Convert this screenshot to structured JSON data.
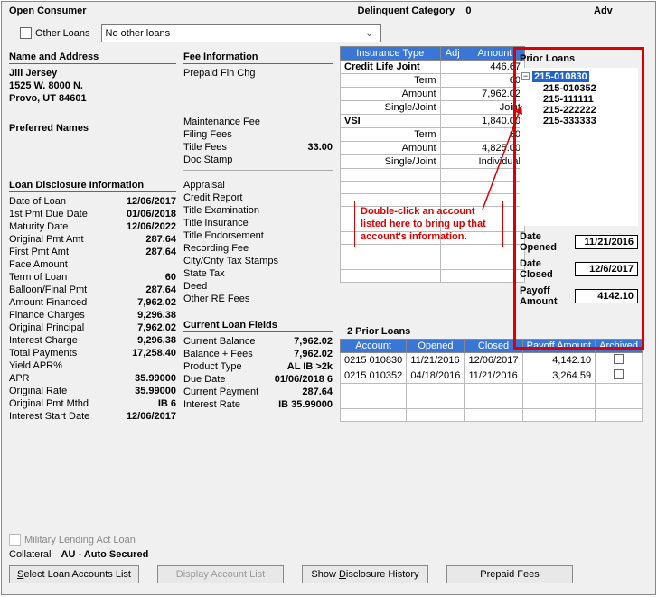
{
  "header": {
    "title": "Open Consumer",
    "delinquent_label": "Delinquent Category",
    "delinquent_value": "0",
    "adv_label": "Adv"
  },
  "other_loans": {
    "checkbox_label": "Other Loans",
    "dropdown_value": "No other loans"
  },
  "name_address": {
    "title": "Name and Address",
    "name": "Jill Jersey",
    "addr1": "1525 W. 8000 N.",
    "addr2": "Provo, UT  84601"
  },
  "preferred_names": {
    "title": "Preferred Names"
  },
  "loan_disclosure": {
    "title": "Loan Disclosure Information",
    "rows": [
      {
        "k": "Date of Loan",
        "v": "12/06/2017"
      },
      {
        "k": "1st Pmt Due Date",
        "v": "01/06/2018"
      },
      {
        "k": "Maturity Date",
        "v": "12/06/2022"
      },
      {
        "k": "Original Pmt Amt",
        "v": "287.64"
      },
      {
        "k": "First Pmt Amt",
        "v": "287.64"
      },
      {
        "k": "Face Amount",
        "v": ""
      },
      {
        "k": "Term of Loan",
        "v": "60"
      },
      {
        "k": "Balloon/Final Pmt",
        "v": "287.64"
      },
      {
        "k": "Amount Financed",
        "v": "7,962.02"
      },
      {
        "k": "Finance Charges",
        "v": "9,296.38"
      },
      {
        "k": "Original Principal",
        "v": "7,962.02"
      },
      {
        "k": "Interest Charge",
        "v": "9,296.38"
      },
      {
        "k": "Total Payments",
        "v": "17,258.40"
      },
      {
        "k": "Yield APR%",
        "v": ""
      },
      {
        "k": "APR",
        "v": "35.99000"
      },
      {
        "k": "Original Rate",
        "v": "35.99000"
      },
      {
        "k": "Original Pmt Mthd",
        "v": "IB  6"
      },
      {
        "k": "Interest Start Date",
        "v": "12/06/2017"
      }
    ]
  },
  "fee_info": {
    "title": "Fee Information",
    "rows1": [
      {
        "k": "Prepaid Fin Chg",
        "v": ""
      }
    ],
    "rows2": [
      {
        "k": "Maintenance Fee",
        "v": ""
      },
      {
        "k": "Filing Fees",
        "v": ""
      },
      {
        "k": "Title Fees",
        "v": "33.00"
      },
      {
        "k": "Doc Stamp",
        "v": ""
      }
    ],
    "rows3": [
      {
        "k": "Appraisal",
        "v": ""
      },
      {
        "k": "Credit Report",
        "v": ""
      },
      {
        "k": "Title Examination",
        "v": ""
      },
      {
        "k": "Title Insurance",
        "v": ""
      },
      {
        "k": "Title Endorsement",
        "v": ""
      },
      {
        "k": "Recording Fee",
        "v": ""
      },
      {
        "k": "City/Cnty Tax Stamps",
        "v": ""
      },
      {
        "k": "State Tax",
        "v": ""
      },
      {
        "k": "Deed",
        "v": ""
      },
      {
        "k": "Other RE Fees",
        "v": ""
      }
    ]
  },
  "current_loan": {
    "title": "Current Loan Fields",
    "rows": [
      {
        "k": "Current Balance",
        "v": "7,962.02"
      },
      {
        "k": "Balance + Fees",
        "v": "7,962.02"
      },
      {
        "k": "Product Type",
        "v": "AL IB >2k"
      },
      {
        "k": "Due Date",
        "v": "01/06/2018  6"
      },
      {
        "k": "Current Payment",
        "v": "287.64"
      },
      {
        "k": "Interest Rate",
        "v": "IB    35.99000"
      }
    ]
  },
  "insurance_table": {
    "headers": [
      "Insurance Type",
      "Adj",
      "Amount"
    ],
    "rows": [
      {
        "c0": "Credit Life Joint",
        "c1": "",
        "c2": "446.67",
        "bold": true
      },
      {
        "c0": "Term",
        "c1": "",
        "c2": "60",
        "bold": false,
        "right0": true
      },
      {
        "c0": "Amount",
        "c1": "",
        "c2": "7,962.02",
        "bold": false,
        "right0": true
      },
      {
        "c0": "Single/Joint",
        "c1": "",
        "c2": "Joint",
        "bold": false,
        "right0": true
      },
      {
        "c0": "VSI",
        "c1": "",
        "c2": "1,840.00",
        "bold": true
      },
      {
        "c0": "Term",
        "c1": "",
        "c2": "60",
        "bold": false,
        "right0": true
      },
      {
        "c0": "Amount",
        "c1": "",
        "c2": "4,825.00",
        "bold": false,
        "right0": true
      },
      {
        "c0": "Single/Joint",
        "c1": "",
        "c2": "Individual",
        "bold": false,
        "right0": true
      }
    ]
  },
  "callout_text": "Double-click an account listed here to bring up that account's information.",
  "prior_loans": {
    "title": "Prior Loans",
    "tree_selected": "215-010830",
    "tree_children": [
      "215-010352",
      "215-111111",
      "215-222222",
      "215-333333"
    ],
    "date_opened_label": "Date Opened",
    "date_opened": "11/21/2016",
    "date_closed_label": "Date Closed",
    "date_closed": "12/6/2017",
    "payoff_label": "Payoff Amount",
    "payoff": "4142.10"
  },
  "prior_grid": {
    "title": "2 Prior Loans",
    "headers": [
      "Account",
      "Opened",
      "Closed",
      "Payoff Amount",
      "Archived"
    ],
    "rows": [
      {
        "acct": "0215 010830",
        "opened": "11/21/2016",
        "closed": "12/06/2017",
        "payoff": "4,142.10"
      },
      {
        "acct": "0215 010352",
        "opened": "04/18/2016",
        "closed": "11/21/2016",
        "payoff": "3,264.59"
      }
    ]
  },
  "military_label": "Military Lending Act Loan",
  "collateral_label": "Collateral",
  "collateral_value": "AU - Auto Secured",
  "buttons": {
    "select": "Select Loan Accounts List",
    "display": "Display Account List",
    "history": "Show Disclosure History",
    "prepaid": "Prepaid Fees"
  }
}
